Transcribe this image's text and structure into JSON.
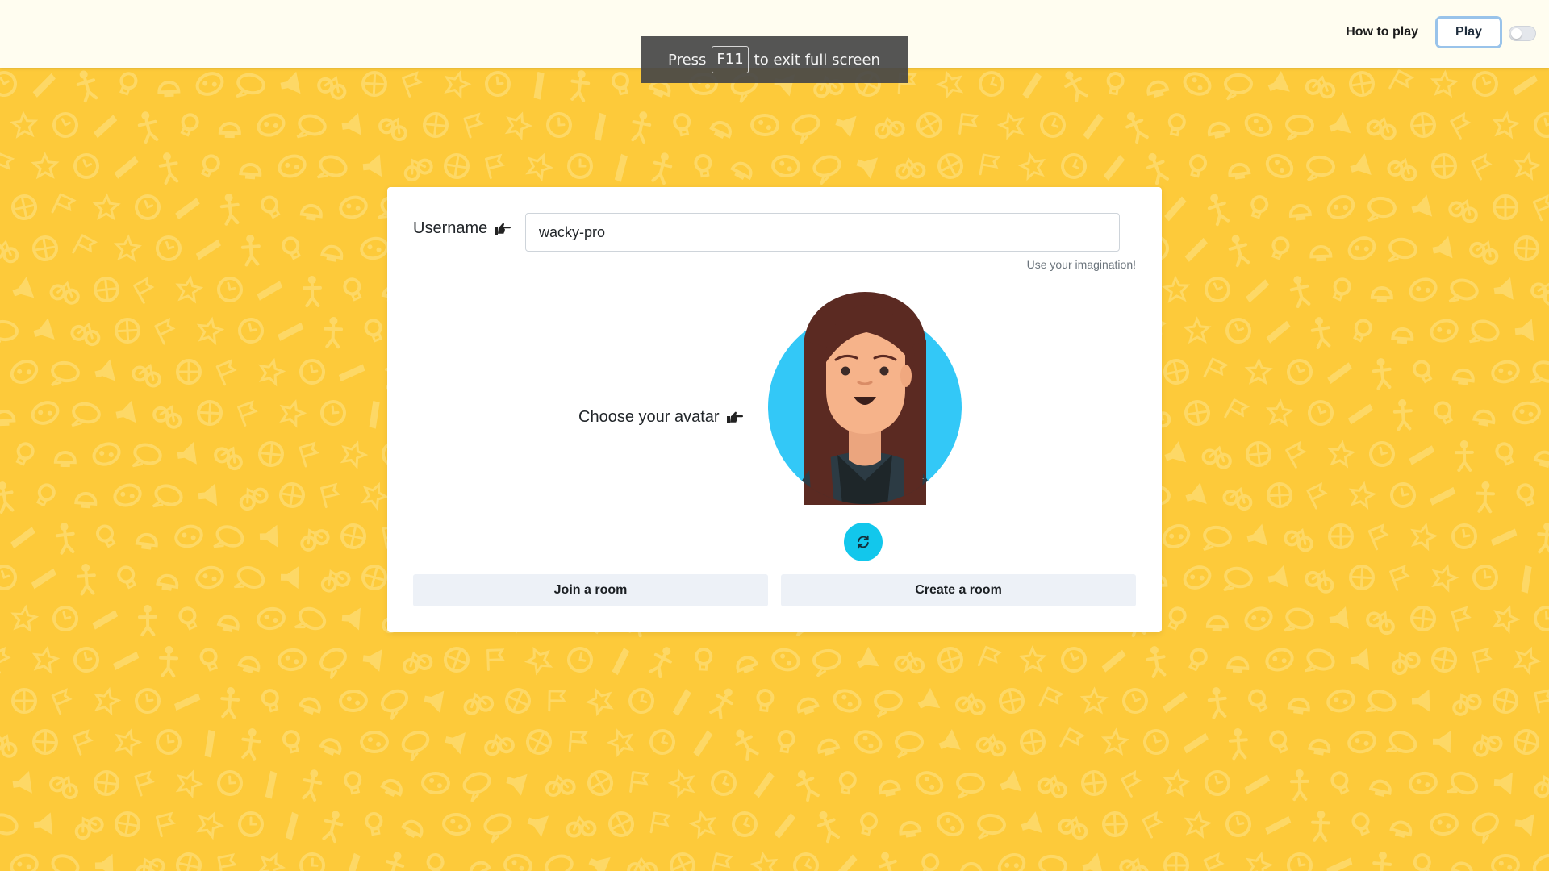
{
  "header": {
    "how_to_play": "How to play",
    "play_label": "Play",
    "theme_toggle": "off"
  },
  "fullscreen_notice": {
    "prefix": "Press",
    "key": "F11",
    "suffix": "to exit full screen"
  },
  "form": {
    "username_label": "Username",
    "username_value": "wacky-pro",
    "username_hint": "Use your imagination!",
    "avatar_label": "Choose your avatar",
    "join_label": "Join a room",
    "create_label": "Create a room"
  },
  "colors": {
    "background": "#fdca3a",
    "accent": "#12c7ec",
    "avatar_bg": "#33c8f7"
  },
  "icons": [
    "point-right-icon",
    "refresh-icon",
    "doodle-pattern"
  ]
}
